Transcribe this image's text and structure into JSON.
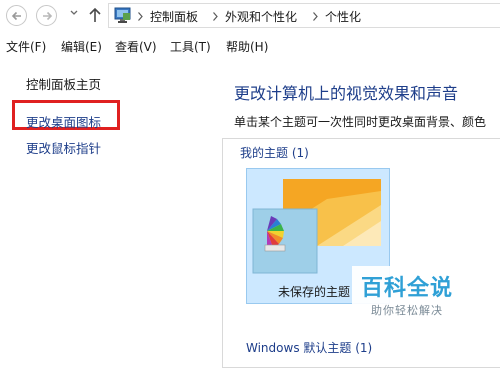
{
  "breadcrumb": [
    "控制面板",
    "外观和个性化",
    "个性化"
  ],
  "menu": [
    "文件(F)",
    "编辑(E)",
    "查看(V)",
    "工具(T)",
    "帮助(H)"
  ],
  "sidebar": {
    "home": "控制面板主页",
    "items": [
      {
        "label": "更改桌面图标",
        "highlighted": true
      },
      {
        "label": "更改鼠标指针",
        "highlighted": false
      }
    ]
  },
  "main": {
    "heading": "更改计算机上的视觉效果和声音",
    "description": "单击某个主题可一次性同时更改桌面背景、颜色",
    "my_themes_label": "我的主题 (1)",
    "theme_tile_name": "未保存的主题",
    "windows_themes_label": "Windows 默认主题 (1)"
  },
  "watermark": {
    "title": "百科全说",
    "subtitle": "助你轻松解决"
  },
  "colors": {
    "link": "#1e3e8a",
    "highlight_box": "#e02020",
    "selected_tile": "#cce8ff",
    "watermark": "#2fa0d6"
  }
}
